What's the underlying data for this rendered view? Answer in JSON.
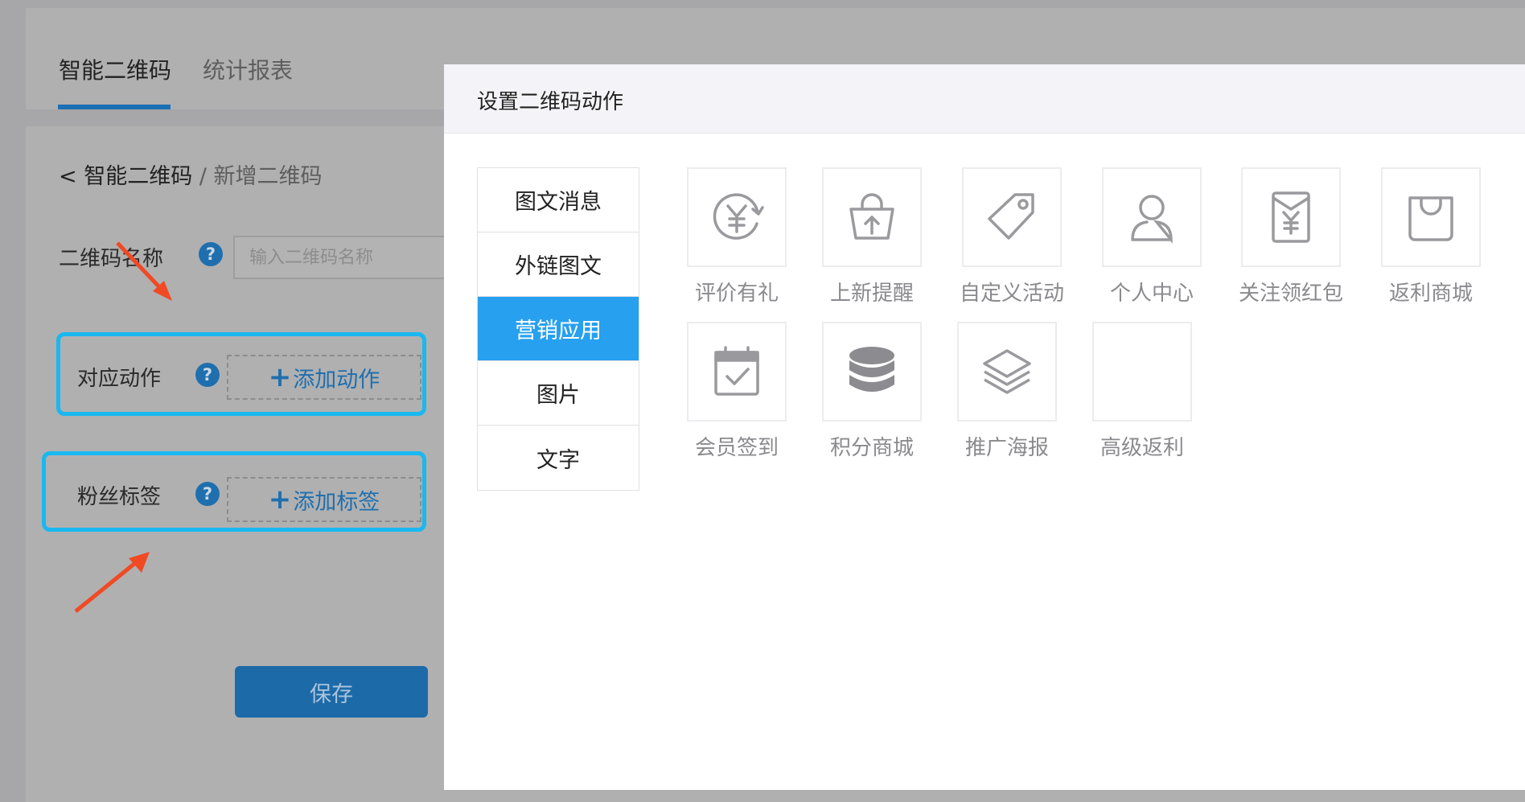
{
  "tabs": [
    {
      "label": "智能二维码",
      "active": true
    },
    {
      "label": "统计报表",
      "active": false
    }
  ],
  "breadcrumb": {
    "back": "< 智能二维码",
    "separator": " / ",
    "current": "新增二维码"
  },
  "form": {
    "name_label": "二维码名称",
    "name_placeholder": "输入二维码名称",
    "action_label": "对应动作",
    "add_action": "添加动作",
    "tag_label": "粉丝标签",
    "add_tag": "添加标签",
    "help_glyph": "?",
    "plus_glyph": "+",
    "save": "保存"
  },
  "modal": {
    "title": "设置二维码动作",
    "categories": [
      {
        "label": "图文消息",
        "active": false
      },
      {
        "label": "外链图文",
        "active": false
      },
      {
        "label": "营销应用",
        "active": true
      },
      {
        "label": "图片",
        "active": false
      },
      {
        "label": "文字",
        "active": false
      }
    ],
    "apps": [
      {
        "label": "评价有礼",
        "icon": "yen-refresh-icon"
      },
      {
        "label": "上新提醒",
        "icon": "upload-bag-icon"
      },
      {
        "label": "自定义活动",
        "icon": "tag-icon"
      },
      {
        "label": "个人中心",
        "icon": "user-icon"
      },
      {
        "label": "关注领红包",
        "icon": "red-envelope-icon"
      },
      {
        "label": "返利商城",
        "icon": "shopping-bag-icon"
      },
      {
        "label": "会员签到",
        "icon": "calendar-check-icon"
      },
      {
        "label": "积分商城",
        "icon": "coin-stack-icon"
      },
      {
        "label": "推广海报",
        "icon": "layers-icon"
      },
      {
        "label": "高级返利",
        "icon": "blank-icon"
      }
    ]
  },
  "colors": {
    "accent": "#27a0ef",
    "highlight": "#19b8f0",
    "annotation_arrow": "#f04a24",
    "primary_dim": "#1d6aa8"
  }
}
